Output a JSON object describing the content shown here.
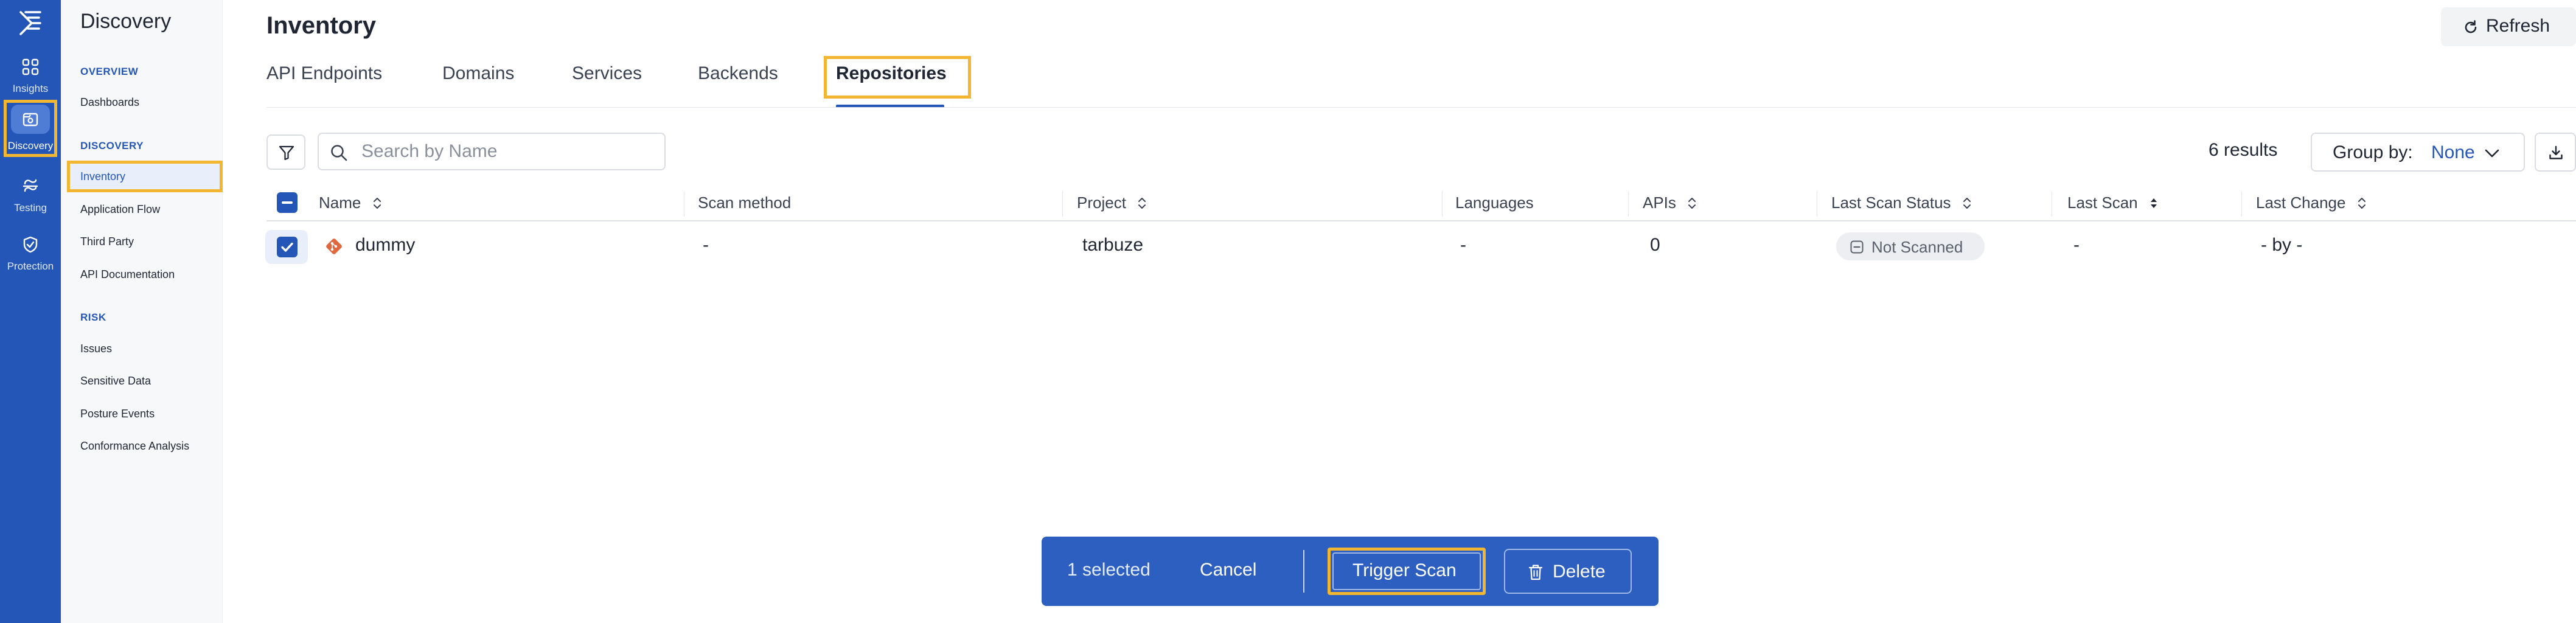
{
  "rail": {
    "items": [
      {
        "label": "Insights",
        "icon": "grid-icon"
      },
      {
        "label": "Discovery",
        "icon": "discovery-icon"
      },
      {
        "label": "Testing",
        "icon": "testing-icon"
      },
      {
        "label": "Protection",
        "icon": "shield-icon"
      }
    ]
  },
  "sidebar": {
    "title": "Discovery",
    "sections": [
      {
        "title": "OVERVIEW",
        "items": [
          "Dashboards"
        ]
      },
      {
        "title": "DISCOVERY",
        "items": [
          "Inventory",
          "Application Flow",
          "Third Party",
          "API Documentation"
        ]
      },
      {
        "title": "RISK",
        "items": [
          "Issues",
          "Sensitive Data",
          "Posture Events",
          "Conformance Analysis"
        ]
      }
    ]
  },
  "header": {
    "title": "Inventory",
    "refresh_label": "Refresh"
  },
  "tabs": [
    {
      "label": "API Endpoints"
    },
    {
      "label": "Domains"
    },
    {
      "label": "Services"
    },
    {
      "label": "Backends"
    },
    {
      "label": "Repositories"
    }
  ],
  "toolbar": {
    "search_placeholder": "Search by Name",
    "results": "6 results",
    "group_by_label": "Group by:",
    "group_by_value": "None"
  },
  "table": {
    "columns": [
      "Name",
      "Scan method",
      "Project",
      "Languages",
      "APIs",
      "Last Scan Status",
      "Last Scan",
      "Last Change"
    ],
    "rows": [
      {
        "name": "dummy",
        "scan_method": "-",
        "project": "tarbuze",
        "languages": "-",
        "apis": "0",
        "last_scan_status": "Not Scanned",
        "last_scan": "-",
        "last_change": "- by -"
      }
    ]
  },
  "bulk_bar": {
    "selected": "1 selected",
    "cancel": "Cancel",
    "trigger_scan": "Trigger Scan",
    "delete": "Delete"
  },
  "colors": {
    "primary": "#2456b8",
    "highlight": "#f2b630",
    "git": "#e0683e"
  }
}
